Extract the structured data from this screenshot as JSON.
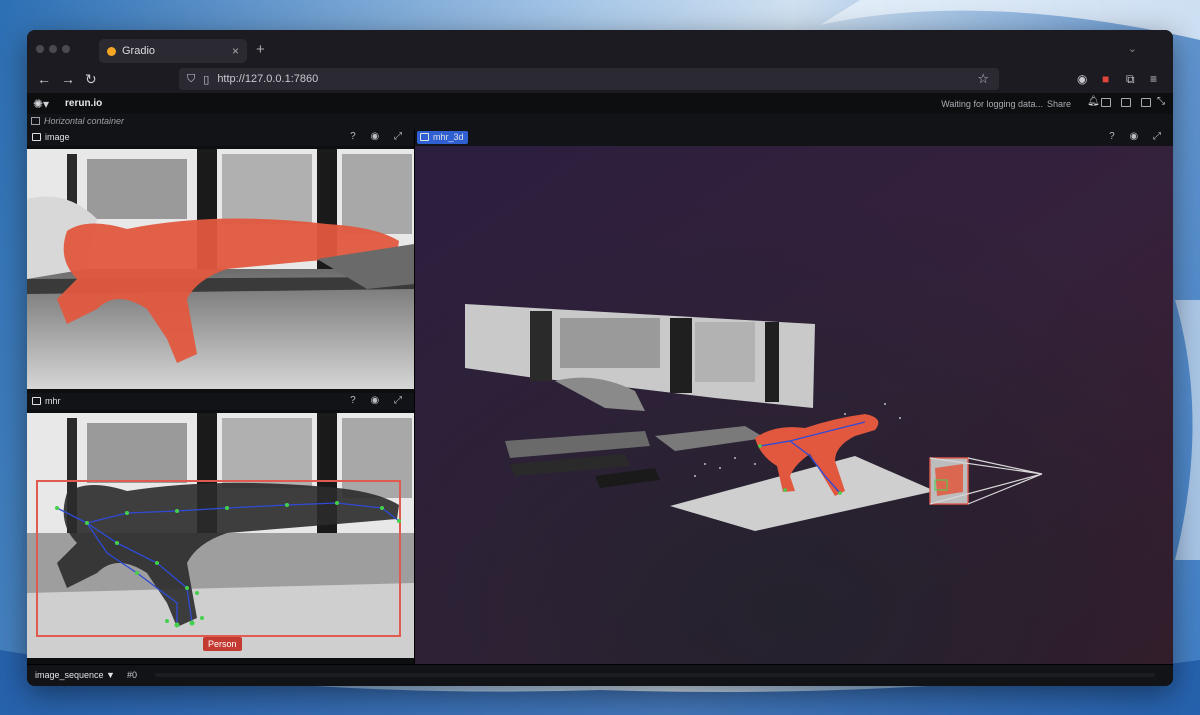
{
  "browser": {
    "tab_title": "Gradio",
    "tab_close": "×",
    "new_tab": "+",
    "url": "http://127.0.0.1:7860"
  },
  "rerun": {
    "app_name": "rerun.io",
    "status": "Waiting for logging data...",
    "share_label": "Share",
    "container_label": "Horizontal container"
  },
  "panels": [
    {
      "id": "image",
      "label": "image",
      "actions": "? ◉ ⤢"
    },
    {
      "id": "mhr",
      "label": "mhr",
      "actions": "? ◉ ⤢"
    },
    {
      "id": "mhr_3d",
      "label": "mhr_3d",
      "actions": "? ◉ ⤢"
    }
  ],
  "annotation": {
    "label": "Person"
  },
  "timeline": {
    "sequence": "image_sequence ▼",
    "frame": "#0"
  },
  "colors": {
    "accent_blue": "#2f5fd1",
    "mesh_red": "#e2583e",
    "box_red": "#e05a4e",
    "keypoint_green": "#43d04b",
    "skeleton_blue": "#2f4bd6"
  }
}
